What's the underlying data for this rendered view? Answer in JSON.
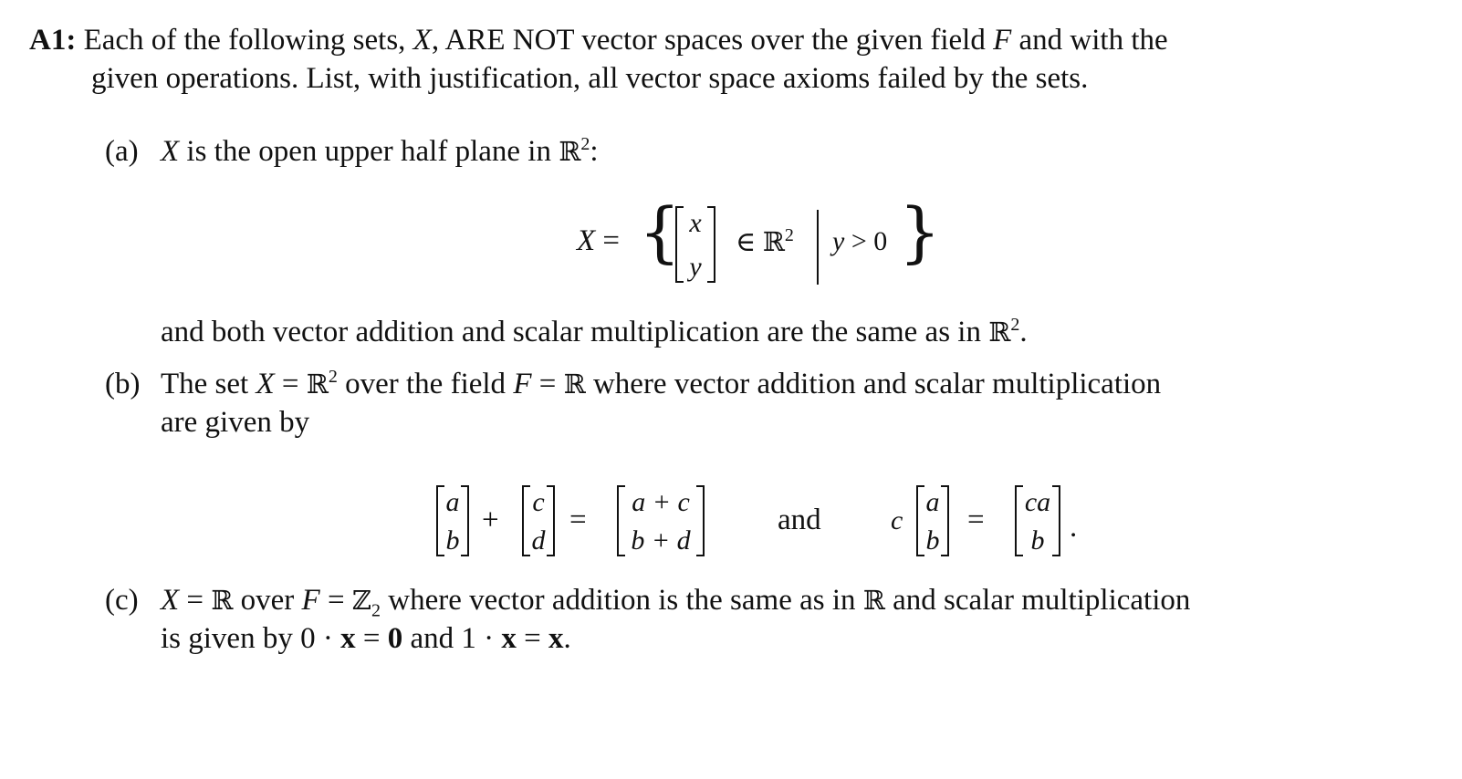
{
  "problem": {
    "label": "A1:",
    "intro_line1": "Each of the following sets, X, ARE NOT vector spaces over the given field F and with the",
    "intro_line2": "given operations. List, with justification, all vector space axioms failed by the sets."
  },
  "parts": {
    "a": {
      "label": "(a)",
      "text": "X is the open upper half plane in ℝ²:",
      "set_lhs": "X =",
      "vector": [
        "x",
        "y"
      ],
      "membership": "∈ ℝ²",
      "condition": "y > 0",
      "after": "and both vector addition and scalar multiplication are the same as in ℝ²."
    },
    "b": {
      "label": "(b)",
      "line1": "The set X = ℝ² over the field F = ℝ where vector addition and scalar multiplication",
      "line2": "are given by",
      "add_left": [
        "a",
        "b"
      ],
      "add_right": [
        "c",
        "d"
      ],
      "add_result": [
        "a + c",
        "b + d"
      ],
      "connector": "and",
      "scalar": "c",
      "scalar_vector": [
        "a",
        "b"
      ],
      "scalar_result": [
        "ca",
        "b"
      ]
    },
    "c": {
      "label": "(c)",
      "line1": "X = ℝ over F = ℤ₂ where vector addition is the same as in ℝ and scalar multiplication",
      "line2": "is given by 0 · x = 0 and 1 · x = x."
    }
  }
}
